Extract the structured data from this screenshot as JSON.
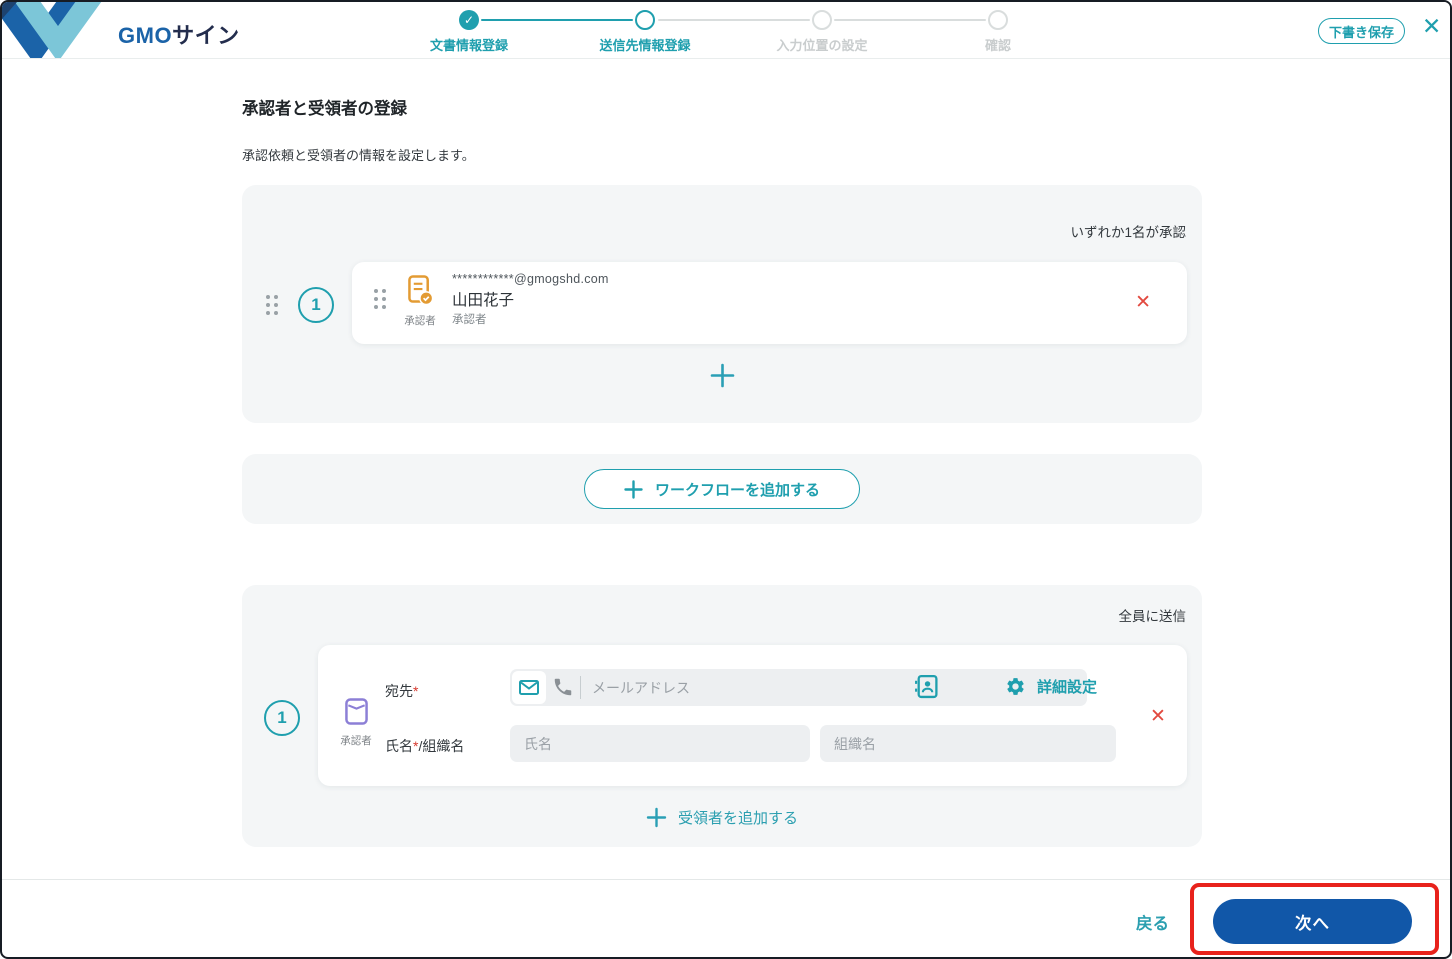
{
  "header": {
    "brand": {
      "gmo": "GMO",
      "sign": "サイン"
    },
    "steps": [
      {
        "label": "文書情報登録",
        "state": "done"
      },
      {
        "label": "送信先情報登録",
        "state": "current"
      },
      {
        "label": "入力位置の設定",
        "state": "upcoming"
      },
      {
        "label": "確認",
        "state": "upcoming"
      }
    ],
    "draft_save_label": "下書き保存"
  },
  "icons": {
    "check": "✓",
    "close": "✕",
    "delete": "✕"
  },
  "page": {
    "title": "承認者と受領者の登録",
    "subtitle": "承認依頼と受領者の情報を設定します。"
  },
  "approval_workflow": {
    "approval_rule": "いずれか1名が承認",
    "order_number": "1",
    "approver": {
      "email": "************@gmogshd.com",
      "name": "山田花子",
      "role": "承認者",
      "icon_label": "承認者"
    }
  },
  "workflow": {
    "add_workflow_label": "ワークフローを追加する"
  },
  "recipients": {
    "send_rule": "全員に送信",
    "order_number": "1",
    "icon_label": "承認者",
    "to_label": "宛先",
    "required_mark": "*",
    "email_placeholder": "メールアドレス",
    "advanced_settings_label": "詳細設定",
    "name_org_label_name": "氏名",
    "name_org_label_rest": "/組織名",
    "name_placeholder": "氏名",
    "org_placeholder": "組織名",
    "add_recipient_label": "受領者を追加する"
  },
  "footer": {
    "back_label": "戻る",
    "next_label": "次へ"
  },
  "colors": {
    "accent_teal": "#1f9fae",
    "primary_blue": "#1157a8",
    "annotation_red": "#e8221c",
    "delete_red": "#e2493f",
    "approver_icon_orange": "#e39b33",
    "recipient_icon_purple": "#8c7fd6"
  }
}
